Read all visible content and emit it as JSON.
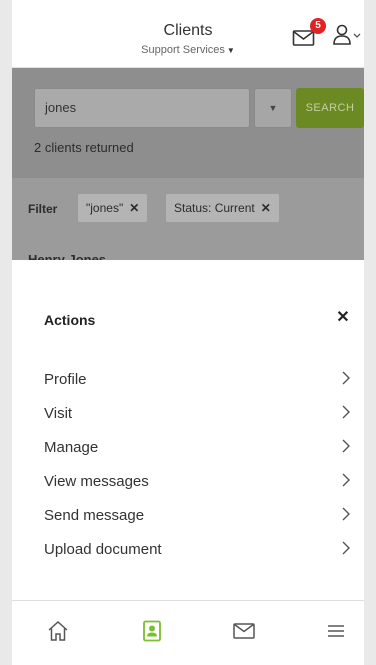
{
  "header": {
    "title": "Clients",
    "subtitle": "Support Services",
    "notification_count": "5",
    "mail_icon": "mail-icon",
    "user_icon": "user-icon"
  },
  "search": {
    "value": "jones",
    "button_label": "SEARCH",
    "results_text": "2 clients returned"
  },
  "filter": {
    "label": "Filter",
    "chips": [
      "\"jones\"",
      "Status: Current"
    ]
  },
  "peek_client": "Henry Jones",
  "actions_sheet": {
    "title": "Actions",
    "items": [
      "Profile",
      "Visit",
      "Manage",
      "View messages",
      "Send message",
      "Upload document"
    ]
  },
  "bottom_nav": {
    "items": [
      "home-icon",
      "contacts-icon",
      "mail-icon",
      "menu-icon"
    ],
    "active": "contacts-icon"
  },
  "colors": {
    "accent_green": "#7cbf2e",
    "badge_red": "#e02424",
    "overlay_gray": "#9b9b9b"
  }
}
